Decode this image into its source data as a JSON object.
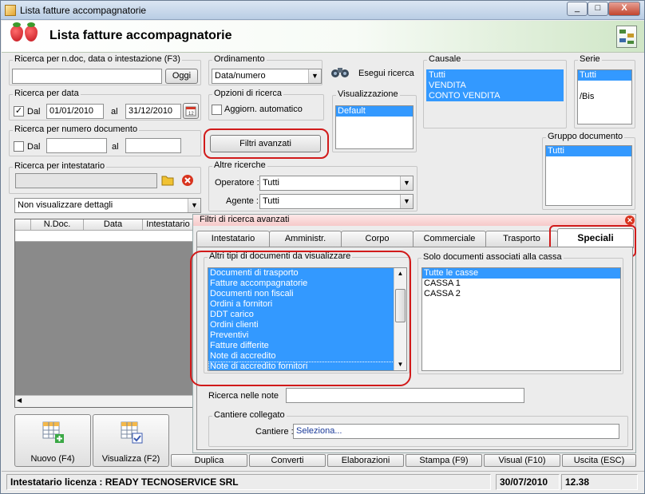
{
  "window": {
    "title": "Lista fatture accompagnatorie",
    "controls": [
      "_",
      "□",
      "X"
    ]
  },
  "header": {
    "title": "Lista fatture accompagnatorie"
  },
  "search_ndoc": {
    "legend": "Ricerca per n.doc, data o intestazione (F3)",
    "value": "",
    "button": "Oggi"
  },
  "ordinamento": {
    "legend": "Ordinamento",
    "value": "Data/numero"
  },
  "esegui": {
    "label": "Esegui ricerca"
  },
  "causale": {
    "legend": "Causale",
    "items": [
      "Tutti",
      "VENDITA",
      "CONTO VENDITA"
    ]
  },
  "serie": {
    "legend": "Serie",
    "items": [
      "Tutti",
      "/Bis"
    ]
  },
  "ricerca_data": {
    "legend": "Ricerca per data",
    "check": "✓",
    "dal_label": "Dal",
    "dal": "01/01/2010",
    "al_label": "al",
    "al": "31/12/2010"
  },
  "opzioni": {
    "legend": "Opzioni di ricerca",
    "auto": "Aggiorn. automatico"
  },
  "visualizzazione": {
    "legend": "Visualizzazione",
    "items": [
      "Default"
    ]
  },
  "ricerca_numero": {
    "legend": "Ricerca per numero documento",
    "dal_label": "Dal",
    "dal": "",
    "al_label": "al",
    "al": ""
  },
  "filtri_btn": "Filtri avanzati",
  "gruppo": {
    "legend": "Gruppo documento",
    "items": [
      "Tutti"
    ]
  },
  "intestatario": {
    "legend": "Ricerca per intestatario",
    "value": ""
  },
  "altre": {
    "legend": "Altre ricerche",
    "operatore_label": "Operatore :",
    "operatore": "Tutti",
    "agente_label": "Agente :",
    "agente": "Tutti"
  },
  "dettagli": {
    "value": "Non visualizzare dettagli"
  },
  "grid": {
    "columns": [
      "N.Doc.",
      "Data",
      "Intestatario"
    ]
  },
  "advanced": {
    "caption": "Filtri di ricerca avanzati",
    "tabs": [
      "Intestatario",
      "Amministr.",
      "Corpo",
      "Commerciale",
      "Trasporto",
      "Speciali"
    ],
    "active_tab": "Speciali",
    "altri_legend": "Altri tipi di documenti da visualizzare",
    "altri_items": [
      "Documenti di trasporto",
      "Fatture accompagnatorie",
      "Documenti non fiscali",
      "Ordini a fornitori",
      "DDT carico",
      "Ordini clienti",
      "Preventivi",
      "Fatture differite",
      "Note di accredito",
      "Note di accredito fornitori"
    ],
    "solo_legend": "Solo documenti associati alla cassa",
    "solo_items": [
      "Tutte le casse",
      "CASSA 1",
      "CASSA 2"
    ],
    "note_label": "Ricerca nelle note",
    "note_value": "",
    "cantiere_legend": "Cantiere collegato",
    "cantiere_label": "Cantiere :",
    "cantiere_value": "Seleziona..."
  },
  "buttons": {
    "nuovo": "Nuovo (F4)",
    "visualizza": "Visualizza (F2)",
    "duplica": "Duplica",
    "converti": "Converti",
    "elaborazioni": "Elaborazioni",
    "stampa": "Stampa (F9)",
    "visual": "Visual (F10)",
    "uscita": "Uscita (ESC)"
  },
  "status": {
    "license": "Intestatario licenza : READY TECNOSERVICE SRL",
    "date": "30/07/2010",
    "time": "12.38"
  },
  "colors": {
    "selection": "#3399ff",
    "highlight_ring": "#d11a1a"
  }
}
